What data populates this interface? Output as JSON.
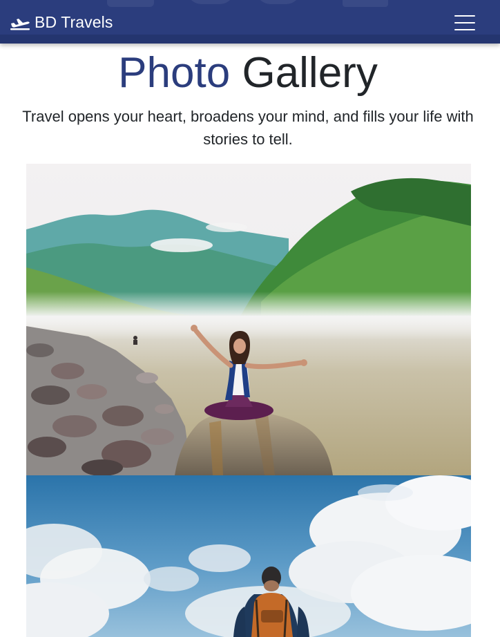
{
  "navbar": {
    "brand": "BD Travels",
    "brand_icon": "plane-takeoff-icon",
    "menu_icon": "hamburger-menu-icon",
    "bg_color": "#2b3d7d"
  },
  "header": {
    "title_accent": "Photo",
    "title_rest": "Gallery",
    "subtitle": "Travel opens your heart, broadens your mind, and fills your life with stories to tell."
  },
  "gallery": {
    "photos": [
      {
        "subject": "woman-sitting-on-river-rock-photo"
      },
      {
        "subject": "hiker-with-backpack-under-sky-photo"
      }
    ]
  }
}
